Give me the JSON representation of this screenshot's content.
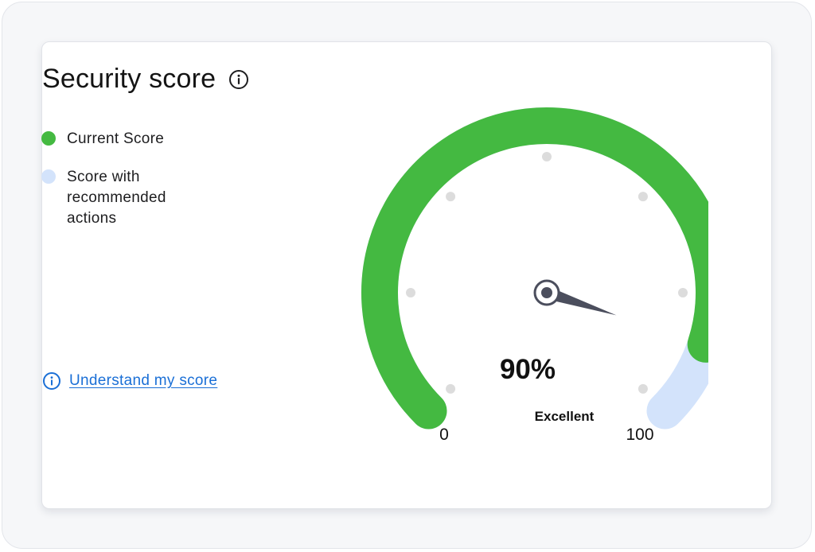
{
  "card": {
    "title": "Security score",
    "info_icon": "info-icon"
  },
  "legend": {
    "items": [
      {
        "label": "Current Score",
        "color": "#44b941"
      },
      {
        "label": "Score with recommended actions",
        "color": "#d3e3fb"
      }
    ]
  },
  "link": {
    "label": "Understand my score",
    "icon": "info-icon",
    "color": "#1a6fd6"
  },
  "gauge": {
    "value_text": "90%",
    "rating": "Excellent",
    "min_label": "0",
    "max_label": "100",
    "current_score": 90,
    "recommended_score": 100,
    "min": 0,
    "max": 100,
    "current_color": "#44b941",
    "recommended_color": "#d3e3fb",
    "needle_color": "#4b4e5d",
    "tick_color": "#dcdcdc"
  }
}
